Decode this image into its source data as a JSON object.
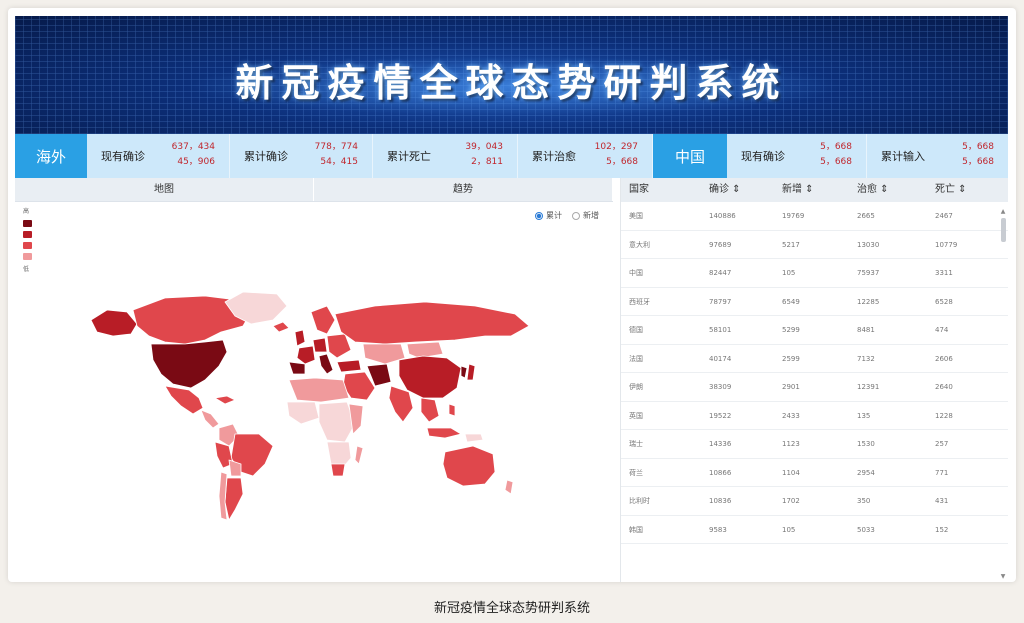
{
  "title": "新冠疫情全球态势研判系统",
  "caption": "新冠疫情全球态势研判系统",
  "stats": {
    "overseas_tag": "海外",
    "china_tag": "中国",
    "items": [
      {
        "label": "现有确诊",
        "values": [
          "637，434",
          "45，906"
        ]
      },
      {
        "label": "累计确诊",
        "values": [
          "778，774",
          "54，415"
        ]
      },
      {
        "label": "累计死亡",
        "values": [
          "39，043",
          "2，811"
        ]
      },
      {
        "label": "累计治愈",
        "values": [
          "102，297",
          "5，668"
        ]
      }
    ],
    "china_items": [
      {
        "label": "现有确诊",
        "values": [
          "5，668",
          "5，668"
        ]
      },
      {
        "label": "累计输入",
        "values": [
          "5，668",
          "5，668"
        ]
      }
    ]
  },
  "tabs": [
    "地图",
    "趋势"
  ],
  "legend": {
    "high": "高",
    "low": "低",
    "colors": [
      "#7a0a14",
      "#b81d26",
      "#e0474c",
      "#f09a9c"
    ]
  },
  "radios": [
    {
      "label": "累计",
      "selected": true
    },
    {
      "label": "新增",
      "selected": false
    }
  ],
  "table": {
    "headers": [
      "国家",
      "确诊 ⇕",
      "新增 ⇕",
      "治愈 ⇕",
      "死亡 ⇕"
    ],
    "rows": [
      [
        "美国",
        "140886",
        "19769",
        "2665",
        "2467"
      ],
      [
        "意大利",
        "97689",
        "5217",
        "13030",
        "10779"
      ],
      [
        "中国",
        "82447",
        "105",
        "75937",
        "3311"
      ],
      [
        "西班牙",
        "78797",
        "6549",
        "12285",
        "6528"
      ],
      [
        "德国",
        "58101",
        "5299",
        "8481",
        "474"
      ],
      [
        "法国",
        "40174",
        "2599",
        "7132",
        "2606"
      ],
      [
        "伊朗",
        "38309",
        "2901",
        "12391",
        "2640"
      ],
      [
        "英国",
        "19522",
        "2433",
        "135",
        "1228"
      ],
      [
        "瑞士",
        "14336",
        "1123",
        "1530",
        "257"
      ],
      [
        "荷兰",
        "10866",
        "1104",
        "2954",
        "771"
      ],
      [
        "比利时",
        "10836",
        "1702",
        "350",
        "431"
      ],
      [
        "韩国",
        "9583",
        "105",
        "5033",
        "152"
      ]
    ]
  }
}
